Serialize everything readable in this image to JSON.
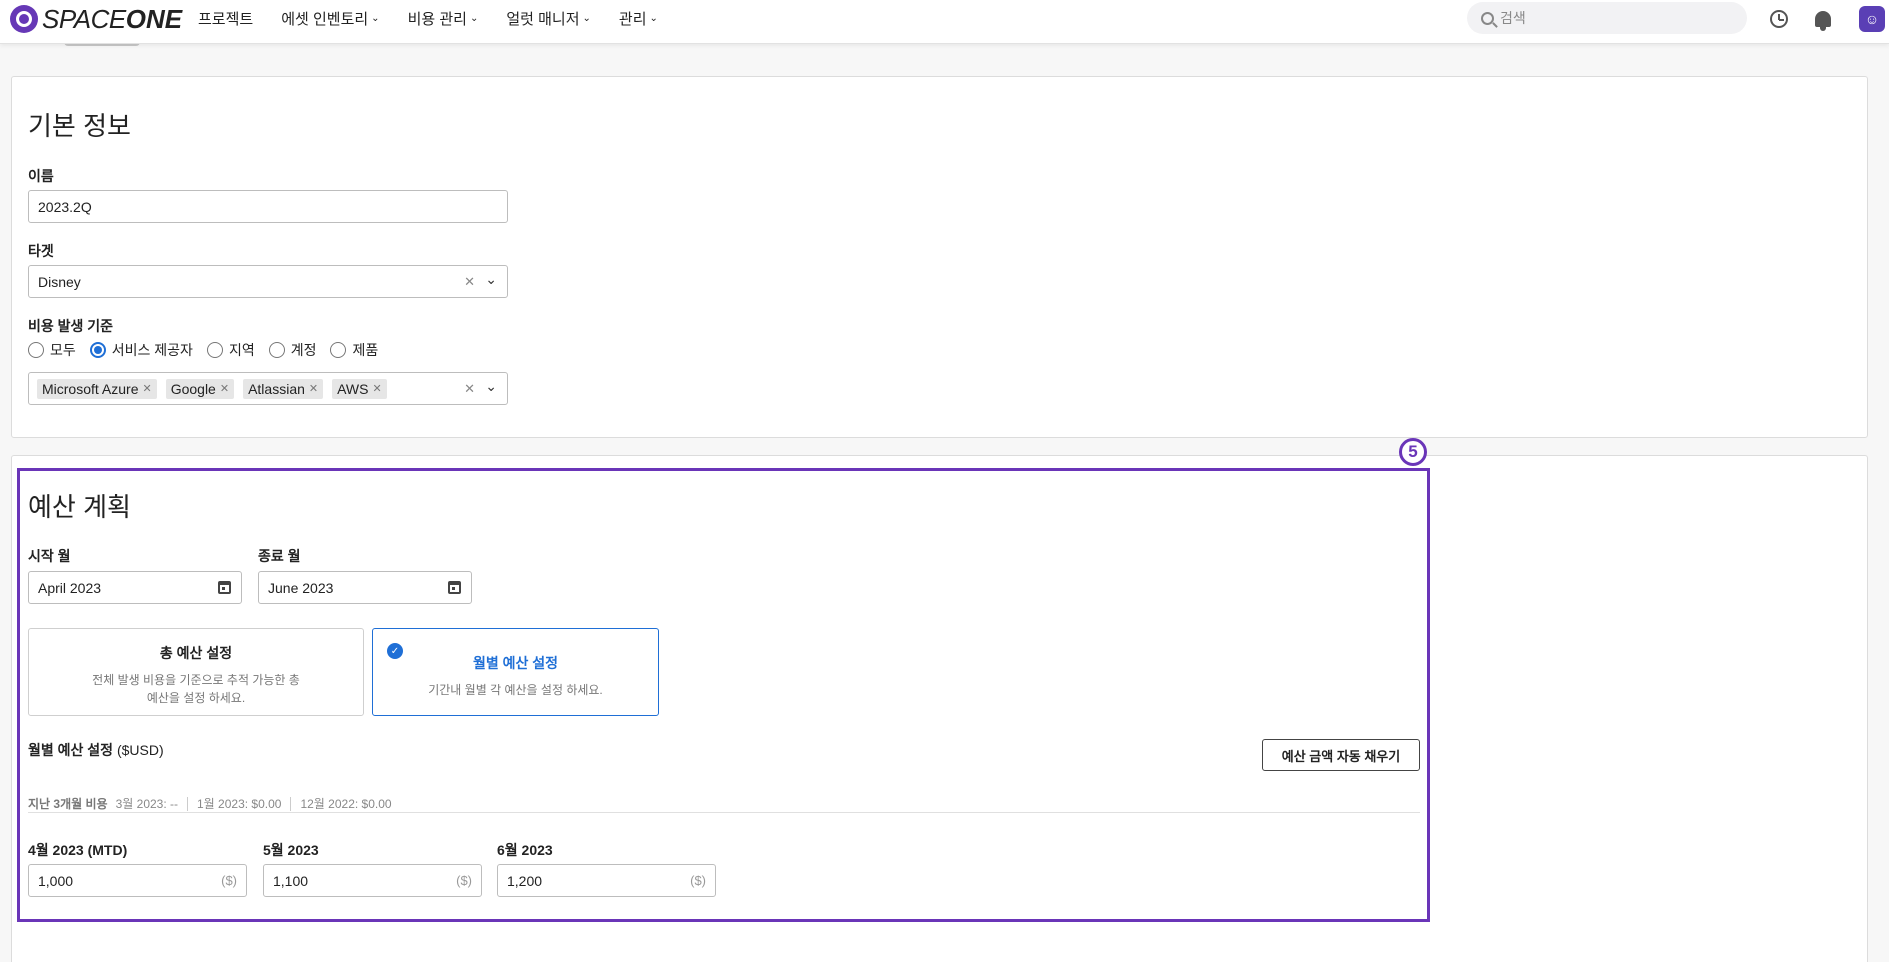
{
  "nav": {
    "logo_text_a": "SPACE",
    "logo_text_b": "ONE",
    "menu": [
      {
        "label": "프로젝트",
        "has_dropdown": false
      },
      {
        "label": "에셋 인벤토리",
        "has_dropdown": true
      },
      {
        "label": "비용 관리",
        "has_dropdown": true
      },
      {
        "label": "얼럿 매니저",
        "has_dropdown": true
      },
      {
        "label": "관리",
        "has_dropdown": true
      }
    ],
    "search_placeholder": "검색"
  },
  "basic_info": {
    "title": "기본 정보",
    "name_label": "이름",
    "name_value": "2023.2Q",
    "target_label": "타겟",
    "target_value": "Disney",
    "cost_basis_label": "비용 발생 기준",
    "radios": [
      {
        "label": "모두",
        "checked": false
      },
      {
        "label": "서비스 제공자",
        "checked": true
      },
      {
        "label": "지역",
        "checked": false
      },
      {
        "label": "계정",
        "checked": false
      },
      {
        "label": "제품",
        "checked": false
      }
    ],
    "tags": [
      "Microsoft Azure",
      "Google",
      "Atlassian",
      "AWS"
    ]
  },
  "budget_plan": {
    "badge": "5",
    "title": "예산 계획",
    "start_label": "시작 월",
    "start_value": "April 2023",
    "end_label": "종료 월",
    "end_value": "June 2023",
    "total_option": {
      "title": "총 예산 설정",
      "desc_line1": "전체 발생 비용을 기준으로 추적 가능한 총",
      "desc_line2": "예산을 설정 하세요."
    },
    "monthly_option": {
      "title": "월별 예산 설정",
      "desc": "기간내 월별 각 예산을 설정 하세요."
    },
    "monthly_label": "월별 예산 설정",
    "currency": "($USD)",
    "autofill_label": "예산 금액 자동 채우기",
    "history_label": "지난 3개월 비용",
    "history": [
      "3월 2023: --",
      "1월 2023: $0.00",
      "12월 2022: $0.00"
    ],
    "months": [
      {
        "label": "4월 2023 (MTD)",
        "value": "1,000",
        "unit": "($)"
      },
      {
        "label": "5월 2023",
        "value": "1,100",
        "unit": "($)"
      },
      {
        "label": "6월 2023",
        "value": "1,200",
        "unit": "($)"
      }
    ]
  },
  "colors": {
    "accent": "#1f6fd6",
    "highlight": "#6a35b8",
    "brand": "#6638b6"
  }
}
